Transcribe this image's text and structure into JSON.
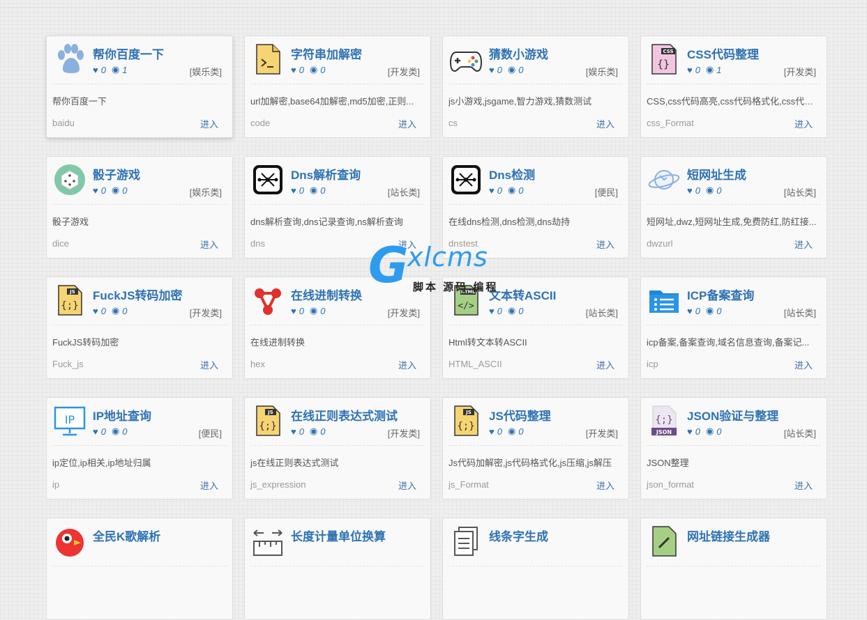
{
  "cards": [
    {
      "title": "帮你百度一下",
      "likes": "0",
      "views": "1",
      "category": "[娱乐类]",
      "desc": "帮你百度一下",
      "slug": "baidu",
      "enter": "进入",
      "icon": "paw-icon"
    },
    {
      "title": "字符串加解密",
      "likes": "0",
      "views": "0",
      "category": "[开发类]",
      "desc": "url加解密,base64加解密,md5加密,正则...",
      "slug": "code",
      "enter": "进入",
      "icon": "terminal-file-icon"
    },
    {
      "title": "猜数小游戏",
      "likes": "0",
      "views": "0",
      "category": "[娱乐类]",
      "desc": "js小游戏,jsgame,智力游戏,猜数测试",
      "slug": "cs",
      "enter": "进入",
      "icon": "gamepad-icon"
    },
    {
      "title": "CSS代码整理",
      "likes": "0",
      "views": "1",
      "category": "[开发类]",
      "desc": "CSS,css代码高亮,css代码格式化,css代码...",
      "slug": "css_Format",
      "enter": "进入",
      "icon": "css-file-icon"
    },
    {
      "title": "骰子游戏",
      "likes": "0",
      "views": "0",
      "category": "[娱乐类]",
      "desc": "骰子游戏",
      "slug": "dice",
      "enter": "进入",
      "icon": "dice-icon"
    },
    {
      "title": "Dns解析查询",
      "likes": "0",
      "views": "0",
      "category": "[站长类]",
      "desc": "dns解析查询,dns记录查询,ns解析查询",
      "slug": "dns",
      "enter": "进入",
      "icon": "dns-network-icon"
    },
    {
      "title": "Dns检测",
      "likes": "0",
      "views": "0",
      "category": "[便民]",
      "desc": "在线dns检测,dns检测,dns劫持",
      "slug": "dnstest",
      "enter": "进入",
      "icon": "dns-network-icon"
    },
    {
      "title": "短网址生成",
      "likes": "0",
      "views": "0",
      "category": "[站长类]",
      "desc": "短网址,dwz,短网址生成,免费防红,防红接...",
      "slug": "dwzurl",
      "enter": "进入",
      "icon": "planet-icon"
    },
    {
      "title": "FuckJS转码加密",
      "likes": "0",
      "views": "0",
      "category": "[开发类]",
      "desc": "FuckJS转码加密",
      "slug": "Fuck_js",
      "enter": "进入",
      "icon": "js-file-icon"
    },
    {
      "title": "在线进制转换",
      "likes": "0",
      "views": "0",
      "category": "[开发类]",
      "desc": "在线进制转换",
      "slug": "hex",
      "enter": "进入",
      "icon": "share-nodes-icon"
    },
    {
      "title": "文本转ASCII",
      "likes": "0",
      "views": "0",
      "category": "[站长类]",
      "desc": "Html转文本转ASCII",
      "slug": "HTML_ASCII",
      "enter": "进入",
      "icon": "html-file-icon"
    },
    {
      "title": "ICP备案查询",
      "likes": "0",
      "views": "0",
      "category": "[站长类]",
      "desc": "icp备案,备案查询,域名信息查询,备案记...",
      "slug": "icp",
      "enter": "进入",
      "icon": "folder-list-icon"
    },
    {
      "title": "IP地址查询",
      "likes": "0",
      "views": "0",
      "category": "[便民]",
      "desc": "ip定位,ip相关,ip地址归属",
      "slug": "ip",
      "enter": "进入",
      "icon": "ip-monitor-icon"
    },
    {
      "title": "在线正则表达式测试",
      "likes": "0",
      "views": "0",
      "category": "[开发类]",
      "desc": "js在线正则表达式测试",
      "slug": "js_expression",
      "enter": "进入",
      "icon": "js-file-icon"
    },
    {
      "title": "JS代码整理",
      "likes": "0",
      "views": "0",
      "category": "[开发类]",
      "desc": "Js代码加解密,js代码格式化,js压缩,js解压",
      "slug": "js_Format",
      "enter": "进入",
      "icon": "js-file-icon"
    },
    {
      "title": "JSON验证与整理",
      "likes": "0",
      "views": "0",
      "category": "[站长类]",
      "desc": "JSON整理",
      "slug": "json_format",
      "enter": "进入",
      "icon": "json-file-icon"
    },
    {
      "title": "全民K歌解析",
      "likes": "",
      "views": "",
      "category": "",
      "desc": "",
      "slug": "",
      "enter": "",
      "icon": "parrot-icon"
    },
    {
      "title": "长度计量单位换算",
      "likes": "",
      "views": "",
      "category": "",
      "desc": "",
      "slug": "",
      "enter": "",
      "icon": "ruler-icon"
    },
    {
      "title": "线条字生成",
      "likes": "",
      "views": "",
      "category": "",
      "desc": "",
      "slug": "",
      "enter": "",
      "icon": "documents-icon"
    },
    {
      "title": "网址链接生成器",
      "likes": "",
      "views": "",
      "category": "",
      "desc": "",
      "slug": "",
      "enter": "",
      "icon": "link-file-icon"
    }
  ],
  "watermark": {
    "brand_g": "G",
    "brand_rest": "xlcms",
    "tagline": "脚本 源码 编程"
  },
  "colors": {
    "title": "#2e72b4",
    "accent": "#2d9bf0",
    "card_bg": "#fafafa",
    "page_bg": "#efefef"
  }
}
